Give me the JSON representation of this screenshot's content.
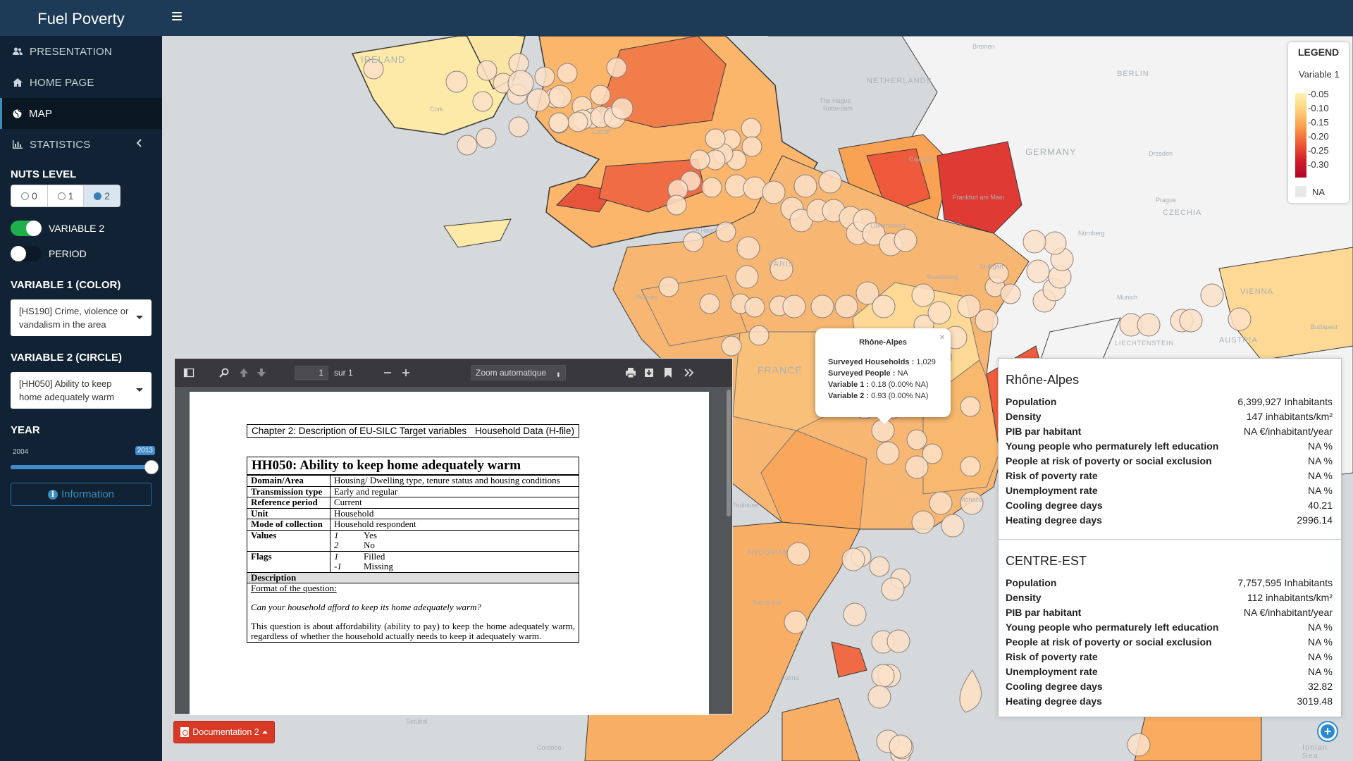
{
  "app": {
    "title": "Fuel Poverty"
  },
  "sidebar": {
    "items": [
      {
        "label": "PRESENTATION"
      },
      {
        "label": "HOME PAGE"
      },
      {
        "label": "MAP"
      },
      {
        "label": "STATISTICS"
      }
    ],
    "nuts_label": "NUTS LEVEL",
    "nuts_options": [
      "0",
      "1",
      "2"
    ],
    "nuts_selected": "2",
    "variable2_toggle_label": "VARIABLE 2",
    "variable2_on": true,
    "period_toggle_label": "PERIOD",
    "period_on": false,
    "variable1_label": "VARIABLE 1 (COLOR)",
    "variable1_value": "[HS190] Crime, violence or vandalism in the area",
    "variable2_label": "VARIABLE 2 (CIRCLE)",
    "variable2_value": "[HH050] Ability to keep home adequately warm",
    "year_label": "YEAR",
    "year_min": "2004",
    "year_value": "2013",
    "year_fraction": 1.0,
    "info_button": "Information"
  },
  "map": {
    "place_labels": [
      "IRELAND",
      "NETHERLANDS",
      "GERMANY",
      "CZECHIA",
      "FRANCE",
      "AUSTRIA",
      "LIECHTENSTEIN",
      "BERLIN",
      "PARIS",
      "ANDORRA",
      "VIENNA",
      "Prague",
      "Munich",
      "Dresden",
      "Budapest",
      "Monaco",
      "The Hague",
      "Rotterdam",
      "Cork",
      "Luxembourg",
      "Frankfurt am Main",
      "Nürnberg",
      "Stuttgart",
      "Strasbourg",
      "Rennes",
      "Le Havre",
      "Toulouse",
      "Barcelona",
      "Palma",
      "Setúbal",
      "Bremen",
      "Cologne",
      "Cardiff",
      "Córdoba",
      "Ionian Sea"
    ],
    "legend": {
      "title": "LEGEND",
      "variable": "Variable 1",
      "ticks": [
        "-0.05",
        "-0.10",
        "-0.15",
        "-0.20",
        "-0.25",
        "-0.30"
      ],
      "na_label": "NA",
      "colors": [
        "#fff2b3",
        "#fed27a",
        "#fa9d4a",
        "#ef5a36",
        "#d21c2a",
        "#b2052a"
      ]
    },
    "popup": {
      "title": "Rhône-Alpes",
      "rows": [
        {
          "key": "Surveyed Households :",
          "value": "1,029"
        },
        {
          "key": "Surveyed People :",
          "value": "NA"
        },
        {
          "key": "Variable 1 :",
          "value": "0.18 (0.00% NA)"
        },
        {
          "key": "Variable 2 :",
          "value": "0.93 (0.00% NA)"
        }
      ],
      "close": "×"
    }
  },
  "info_panel": {
    "regions": [
      {
        "name": "Rhône-Alpes",
        "rows": [
          {
            "k": "Population",
            "v": "6,399,927 Inhabitants"
          },
          {
            "k": "Density",
            "v": "147 inhabitants/km²"
          },
          {
            "k": "PIB par habitant",
            "v": "NA €/inhabitant/year"
          },
          {
            "k": "Young people who permaturely left education",
            "v": "NA %"
          },
          {
            "k": "People at risk of poverty or social exclusion",
            "v": "NA %"
          },
          {
            "k": "Risk of poverty rate",
            "v": "NA %"
          },
          {
            "k": "Unemployment rate",
            "v": "NA %"
          },
          {
            "k": "Cooling degree days",
            "v": "40.21"
          },
          {
            "k": "Heating degree days",
            "v": "2996.14"
          }
        ]
      },
      {
        "name": "CENTRE-EST",
        "rows": [
          {
            "k": "Population",
            "v": "7,757,595 Inhabitants"
          },
          {
            "k": "Density",
            "v": "112 inhabitants/km²"
          },
          {
            "k": "PIB par habitant",
            "v": "NA €/inhabitant/year"
          },
          {
            "k": "Young people who permaturely left education",
            "v": "NA %"
          },
          {
            "k": "People at risk of poverty or social exclusion",
            "v": "NA %"
          },
          {
            "k": "Risk of poverty rate",
            "v": "NA %"
          },
          {
            "k": "Unemployment rate",
            "v": "NA %"
          },
          {
            "k": "Cooling degree days",
            "v": "32.82"
          },
          {
            "k": "Heating degree days",
            "v": "3019.48"
          }
        ]
      }
    ]
  },
  "pdf": {
    "page_value": "1",
    "page_of": "sur 1",
    "zoom": "Zoom automatique",
    "header_left": "Chapter 2: Description of EU-SILC Target variables",
    "header_right": "Household Data (H-file)",
    "title": "HH050: Ability to keep home adequately warm",
    "meta": [
      {
        "k": "Domain/Area",
        "v": "Housing/ Dwelling type, tenure status and housing conditions"
      },
      {
        "k": "Transmission type",
        "v": "Early and regular"
      },
      {
        "k": "Reference period",
        "v": "Current"
      },
      {
        "k": "Unit",
        "v": "Household"
      },
      {
        "k": "Mode of collection",
        "v": "Household respondent"
      }
    ],
    "values_label": "Values",
    "values": [
      {
        "code": "1",
        "label": "Yes"
      },
      {
        "code": "2",
        "label": "No"
      }
    ],
    "flags_label": "Flags",
    "flags": [
      {
        "code": "1",
        "label": "Filled"
      },
      {
        "code": "-1",
        "label": "Missing"
      }
    ],
    "description_label": "Description",
    "format_label": "Format of the question:",
    "question": "Can your household afford to keep its home adequately warm?",
    "body": "This question is about affordability (ability to pay) to keep the home adequately warm, regardless of whether the household actually needs to keep it adequately warm."
  },
  "doc_button": "Documentation 2"
}
